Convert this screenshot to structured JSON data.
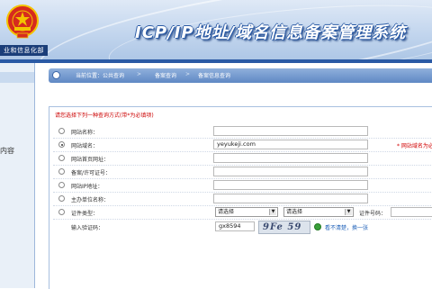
{
  "header": {
    "title": "ICP/IP地址/域名信息备案管理系统",
    "dept": "业和信息化部"
  },
  "sidebar": {
    "items": [
      "内容"
    ]
  },
  "breadcrumb": {
    "items": [
      "当前位置：公共查询",
      "备案查询",
      "备案信息查询"
    ]
  },
  "form": {
    "instruction": "请您选择下列一种查询方式(带*为必填项)",
    "rows": [
      {
        "label": "网站名称：",
        "value": "",
        "checked": false
      },
      {
        "label": "网站域名：",
        "value": "yeyukeji.com",
        "checked": true,
        "hint": "* 网站域名为必"
      },
      {
        "label": "网站首页网址：",
        "value": "",
        "checked": false
      },
      {
        "label": "备案/许可证号：",
        "value": "",
        "checked": false
      },
      {
        "label": "网站IP地址：",
        "value": "",
        "checked": false
      },
      {
        "label": "主办单位名称：",
        "value": "",
        "checked": false
      }
    ],
    "cert_row": {
      "label": "证件类型：",
      "select1": "请选择",
      "select2": "请选择",
      "cert_no_label": "证件号码："
    },
    "captcha_row": {
      "label": "输入验证码：",
      "value": "gx8594",
      "captcha_text": "9Fe 59 4",
      "refresh_text": "看不清楚，换一张"
    }
  },
  "colors": {
    "header_blue": "#2a5aa5",
    "hint_red": "#d10000",
    "link_blue": "#1c5fb8"
  }
}
